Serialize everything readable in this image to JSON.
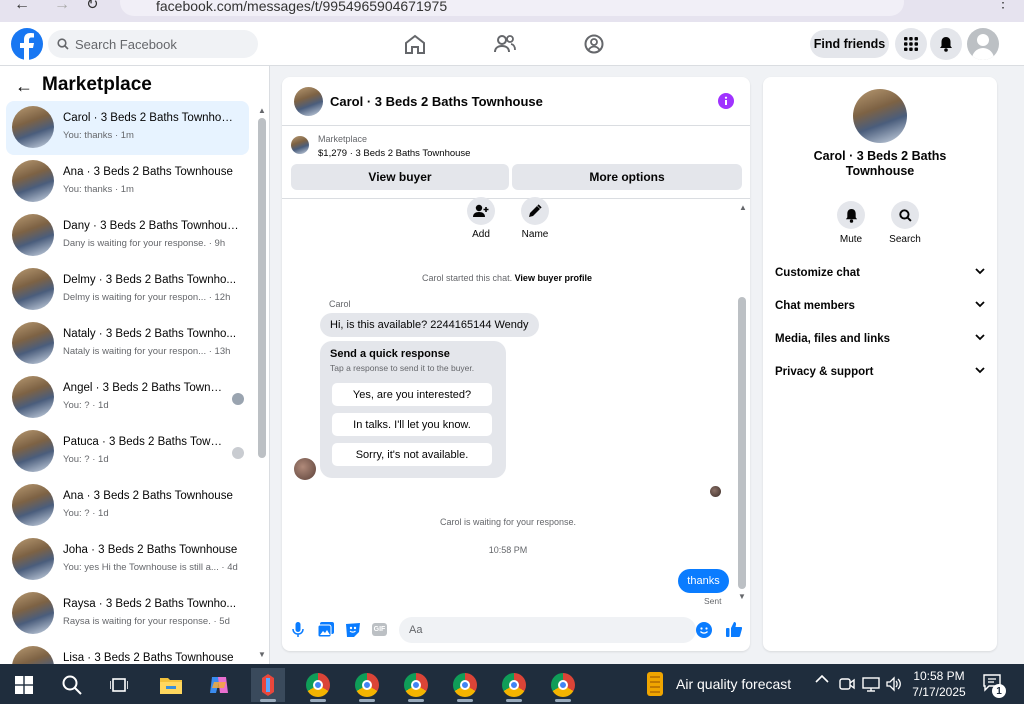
{
  "browser": {
    "url": "facebook.com/messages/t/9954965904671975"
  },
  "header": {
    "search_placeholder": "Search Facebook",
    "find_friends": "Find friends"
  },
  "sidebar": {
    "title": "Marketplace",
    "conversations": [
      {
        "name": "Carol · 3 Beds 2 Baths Townhouse",
        "preview": "You: thanks · 1m"
      },
      {
        "name": "Ana · 3 Beds 2 Baths Townhouse",
        "preview": "You: thanks · 1m"
      },
      {
        "name": "Dany · 3 Beds 2 Baths Townhouse",
        "preview": "Dany is waiting for your response. · 9h"
      },
      {
        "name": "Delmy · 3 Beds 2 Baths Townho...",
        "preview": "Delmy is waiting for your respon... · 12h"
      },
      {
        "name": "Nataly · 3 Beds 2 Baths Townho...",
        "preview": "Nataly is waiting for your respon... · 13h"
      },
      {
        "name": "Angel · 3 Beds 2 Baths Townh...",
        "preview": "You: ? · 1d"
      },
      {
        "name": "Patuca · 3 Beds 2 Baths Town...",
        "preview": "You: ? · 1d"
      },
      {
        "name": "Ana · 3 Beds 2 Baths Townhouse",
        "preview": "You: ? · 1d"
      },
      {
        "name": "Joha · 3 Beds 2 Baths Townhouse",
        "preview": "You: yes Hi the Townhouse is still a... · 4d"
      },
      {
        "name": "Raysa · 3 Beds 2 Baths Townho...",
        "preview": "Raysa is waiting for your response. · 5d"
      },
      {
        "name": "Lisa · 3 Beds 2 Baths Townhouse",
        "preview": ""
      }
    ]
  },
  "chat": {
    "title": "Carol · 3 Beds 2 Baths Townhouse",
    "listing": {
      "label": "Marketplace",
      "price_title": "$1,279 · 3 Beds 2 Baths Townhouse"
    },
    "view_buyer": "View buyer",
    "more_options": "More options",
    "tools": {
      "add": "Add",
      "name": "Name"
    },
    "started_text": "Carol started this chat.",
    "view_profile": "View buyer profile",
    "sender": "Carol",
    "message": "Hi, is this available? 2244165144 Wendy",
    "quick": {
      "title": "Send a quick response",
      "subtitle": "Tap a response to send it to the buyer.",
      "options": [
        "Yes, are you interested?",
        "In talks. I'll let you know.",
        "Sorry, it's not available."
      ]
    },
    "waiting": "Carol is waiting for your response.",
    "time": "10:58 PM",
    "sent_message": "thanks",
    "sent_status": "Sent",
    "composer_placeholder": "Aa"
  },
  "details": {
    "name": "Carol · 3 Beds 2 Baths Townhouse",
    "mute": "Mute",
    "search": "Search",
    "sections": [
      "Customize chat",
      "Chat members",
      "Media, files and links",
      "Privacy & support"
    ]
  },
  "taskbar": {
    "weather": "Air quality forecast",
    "time": "10:58 PM",
    "date": "7/17/2025",
    "notif_count": "1"
  },
  "colors": {
    "brand": "#1877f2",
    "info": "#a033ff",
    "taskbar": "#1f2d3d"
  }
}
